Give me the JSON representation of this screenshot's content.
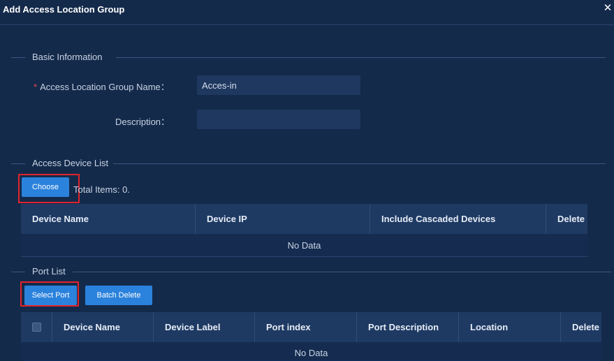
{
  "dialog": {
    "title": "Add Access Location Group",
    "close_symbol": "✕"
  },
  "basic_info": {
    "section_label": "Basic Information",
    "name_label": "Access Location Group Name",
    "name_required_mark": "*",
    "name_value": "Acces-in",
    "description_label": "Description",
    "description_value": "",
    "colon": "："
  },
  "device_list": {
    "section_label": "Access Device List",
    "choose_label": "Choose",
    "total_items": "Total Items: 0.",
    "columns": [
      "Device Name",
      "Device IP",
      "Include Cascaded Devices",
      "Delete"
    ],
    "empty_text": "No Data"
  },
  "port_list": {
    "section_label": "Port List",
    "select_port_label": "Select Port",
    "batch_delete_label": "Batch Delete",
    "columns": [
      "Device Name",
      "Device Label",
      "Port index",
      "Port Description",
      "Location",
      "Delete"
    ],
    "empty_text": "No Data"
  }
}
